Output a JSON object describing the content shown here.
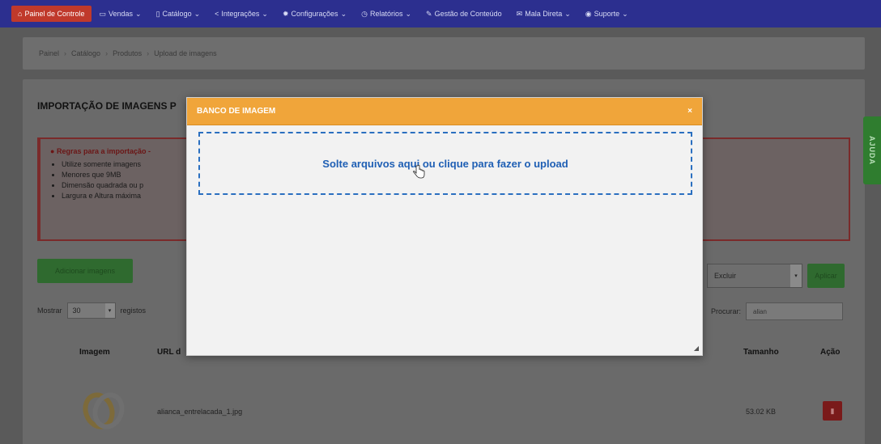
{
  "nav": {
    "items": [
      {
        "label": "Painel de Controle",
        "icon": "home-icon"
      },
      {
        "label": "Vendas",
        "icon": "cart-icon"
      },
      {
        "label": "Catálogo",
        "icon": "book-icon"
      },
      {
        "label": "Integrações",
        "icon": "share-icon"
      },
      {
        "label": "Configurações",
        "icon": "gear-icon"
      },
      {
        "label": "Relatórios",
        "icon": "clock-icon"
      },
      {
        "label": "Gestão de Conteúdo",
        "icon": "edit-icon"
      },
      {
        "label": "Mala Direta",
        "icon": "mail-icon"
      },
      {
        "label": "Suporte",
        "icon": "support-icon"
      }
    ]
  },
  "breadcrumb": [
    "Painel",
    "Catálogo",
    "Produtos",
    "Upload de imagens"
  ],
  "page": {
    "title": "IMPORTAÇÃO DE IMAGENS P",
    "rules_head": "Regras para a importação -",
    "rules": [
      "Utilize somente imagens",
      "Menores que 9MB",
      "Dimensão quadrada ou p",
      "Largura e Altura máxima"
    ],
    "add_button": "Adicionar imagens",
    "show_label": "Mostrar",
    "show_value": "30",
    "records_label": "registos",
    "bulk_action": "Excluir",
    "apply_button": "Aplicar",
    "search_label": "Procurar:",
    "search_value": "alian",
    "columns": {
      "image": "Imagem",
      "url": "URL d",
      "size": "Tamanho",
      "action": "Ação"
    },
    "rows": [
      {
        "url": "alianca_entrelacada_1.jpg",
        "size": "53.02 KB",
        "action_icon": "trash-icon"
      }
    ],
    "help_tab": "AJUDA"
  },
  "modal": {
    "title": "BANCO DE IMAGEM",
    "close": "×",
    "dropzone_text": "Solte arquivos aqui ou clique para fazer o upload"
  }
}
